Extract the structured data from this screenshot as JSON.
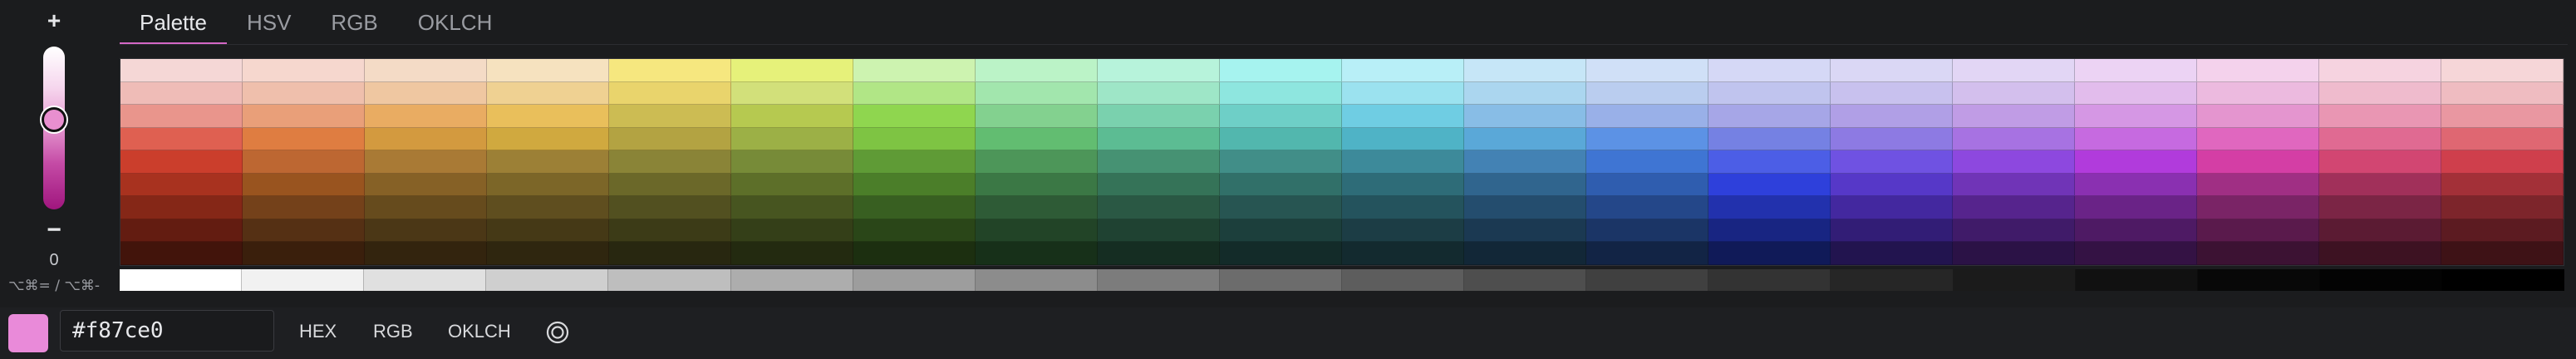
{
  "slider": {
    "plus_label": "+",
    "minus_label": "−",
    "value": "0",
    "shortcut": "⌥⌘= / ⌥⌘-",
    "level": 0.45
  },
  "tabs": [
    {
      "label": "Palette",
      "active": true
    },
    {
      "label": "HSV",
      "active": false
    },
    {
      "label": "RGB",
      "active": false
    },
    {
      "label": "OKLCH",
      "active": false
    }
  ],
  "palette": {
    "columns": 20,
    "rows": [
      [
        "#f5d7d6",
        "#f6d7ce",
        "#f4dbc6",
        "#f6e2bf",
        "#f6e77f",
        "#e6f17a",
        "#cdf3b0",
        "#bbf3c7",
        "#b7f3db",
        "#a6f3ef",
        "#b8eff7",
        "#c6e6f7",
        "#d0e0f7",
        "#d5d8f6",
        "#dad7f5",
        "#e2d6f5",
        "#ecd3f4",
        "#f4d2ec",
        "#f6d3e0",
        "#f6d6d8"
      ],
      [
        "#efbcb7",
        "#efbfac",
        "#efc7a1",
        "#efd192",
        "#e9d46c",
        "#d2e07a",
        "#b1e686",
        "#a2e6ad",
        "#9ee6c7",
        "#8ee6df",
        "#9be2ef",
        "#abd6ef",
        "#bacdef",
        "#c0c4ee",
        "#c8c1ee",
        "#d3bfed",
        "#e2bcec",
        "#ecbadf",
        "#efbbcd",
        "#efbcc1"
      ],
      [
        "#e9958c",
        "#e99f79",
        "#e9ac62",
        "#e9bf5b",
        "#ccbc53",
        "#b6c950",
        "#8fd64f",
        "#83d18f",
        "#7ad1ae",
        "#6ecfc7",
        "#6fcde3",
        "#88bde6",
        "#99b0e8",
        "#a6a6e7",
        "#b09fe6",
        "#c09ce5",
        "#d597e4",
        "#e495cf",
        "#e996b3",
        "#e997a1"
      ],
      [
        "#df6051",
        "#df7d41",
        "#d39a3f",
        "#d0a93f",
        "#b3a342",
        "#9cb046",
        "#7ec443",
        "#62bd71",
        "#5cbc93",
        "#52b7ae",
        "#4fb3c6",
        "#5aa8d8",
        "#5c92e5",
        "#7581e3",
        "#8d7ae3",
        "#a772e2",
        "#c66ae0",
        "#e067bf",
        "#e06a92",
        "#df6772"
      ],
      [
        "#cb3e2c",
        "#bd6732",
        "#a97a35",
        "#9c8036",
        "#8a8437",
        "#778b38",
        "#5f9b36",
        "#4d9659",
        "#469273",
        "#418e88",
        "#3d8a9a",
        "#4382b4",
        "#3f75d3",
        "#4c5ee6",
        "#6f52e2",
        "#8d48df",
        "#b13bdc",
        "#d43ea5",
        "#d24672",
        "#cf3f4c"
      ],
      [
        "#a8321f",
        "#99541f",
        "#866126",
        "#7c6628",
        "#6b6829",
        "#5d6f29",
        "#4b7e29",
        "#3b7845",
        "#357358",
        "#317069",
        "#2e6c78",
        "#30658e",
        "#2f5daf",
        "#2e40db",
        "#5638c8",
        "#7034b7",
        "#8a30b1",
        "#a02f84",
        "#a1305a",
        "#a33038"
      ],
      [
        "#852717",
        "#74411a",
        "#664b1d",
        "#5f4e1f",
        "#525020",
        "#475520",
        "#385f21",
        "#2e5b36",
        "#2a5844",
        "#275552",
        "#24535d",
        "#244d6e",
        "#244789",
        "#2231ad",
        "#43289f",
        "#56248d",
        "#6a2387",
        "#7a2466",
        "#7b2545",
        "#7d252b"
      ],
      [
        "#631c11",
        "#553014",
        "#4b3716",
        "#453916",
        "#3c3b17",
        "#343f18",
        "#2a4618",
        "#224427",
        "#1f4232",
        "#1c3f3c",
        "#1c3d45",
        "#1b3952",
        "#1b3566",
        "#182582",
        "#321d76",
        "#401b69",
        "#4e1a64",
        "#5a1a4c",
        "#5b1b33",
        "#5c1b21"
      ],
      [
        "#42140b",
        "#3a1f0c",
        "#33240e",
        "#2f260f",
        "#282710",
        "#232a10",
        "#1c2f10",
        "#173019",
        "#152d22",
        "#132b29",
        "#132a2f",
        "#122737",
        "#122445",
        "#101a58",
        "#22144f",
        "#2b1246",
        "#341244",
        "#3c1233",
        "#3d1222",
        "#3e1216"
      ]
    ],
    "grays": [
      "#ffffff",
      "#f1f1f1",
      "#e0e0e0",
      "#cfcfcf",
      "#bebebe",
      "#adadad",
      "#9d9d9d",
      "#8c8c8c",
      "#7c7c7c",
      "#6c6c6c",
      "#5d5d5d",
      "#4e4e4e",
      "#404040",
      "#333333",
      "#262626",
      "#1b1b1b",
      "#111111",
      "#080808",
      "#030303",
      "#000000"
    ]
  },
  "color": {
    "current_hex": "#f87ce0",
    "swatch_color": "#e98ad9"
  },
  "formats": {
    "hex_label": "HEX",
    "rgb_label": "RGB",
    "oklch_label": "OKLCH",
    "picker_icon": "eyedropper-target-icon"
  }
}
